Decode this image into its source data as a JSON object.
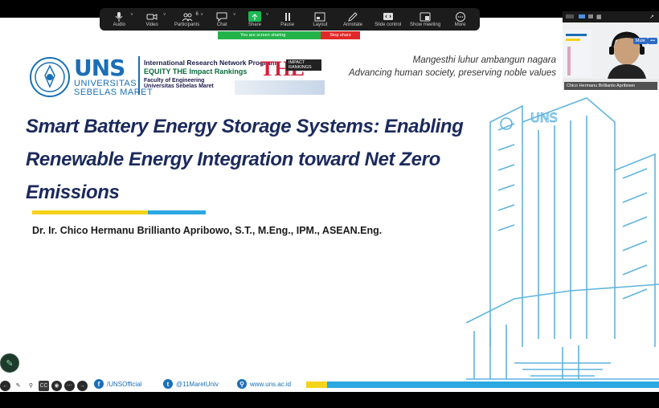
{
  "toolbar": {
    "audio": "Audio",
    "video": "Video",
    "participants": "Participants",
    "participants_count": "6",
    "chat": "Chat",
    "share": "Share",
    "pause": "Pause",
    "layout": "Layout",
    "annotate": "Annotate",
    "slide_control": "Slide control",
    "show_meeting": "Show meeting",
    "more": "More"
  },
  "share_bar": {
    "status": "You are screen sharing",
    "stop": "Stop share"
  },
  "video_tile": {
    "name": "Chico Hermanu Brillianto Apribowo",
    "mute": "Mute",
    "more": "•••"
  },
  "slide": {
    "uns_big": "UNS",
    "uns_line1": "UNIVERSITAS",
    "uns_line2": "SEBELAS MARET",
    "irn_line1": "International Research Network Program",
    "irn_line2": "EQUITY THE Impact Rankings",
    "irn_line3": "Faculty of Engineering",
    "irn_line4": "Universitas Sebelas Maret",
    "the_big": "THE",
    "the_badge1": "IMPACT",
    "the_badge2": "RANKINGS",
    "motto_line1": "Mangesthi luhur ambangun nagara",
    "motto_line2": "Advancing human society, preserving noble values",
    "title_line1": "Smart Battery Energy Storage Systems: Enabling",
    "title_line2": "Renewable Energy Integration toward Net Zero",
    "title_line3": "Emissions",
    "author": "Dr. Ir. Chico Hermanu Brillianto Apribowo, S.T., M.Eng., IPM., ASEAN.Eng.",
    "footer": {
      "facebook": "/UNSOfficial",
      "twitter": "@11MaretUniv",
      "web": "www.uns.ac.id"
    }
  },
  "colors": {
    "title": "#1b2a5c",
    "uns_blue": "#1a6fb5",
    "accent_yellow": "#f5d31a",
    "accent_blue": "#2ba8e0",
    "share_green": "#24b24b",
    "stop_red": "#e02828"
  },
  "icons": {
    "audio": "microphone-icon",
    "video": "camera-icon",
    "participants": "people-icon",
    "chat": "chat-bubble-icon",
    "share": "share-screen-icon",
    "pause": "pause-icon",
    "layout": "layout-icon",
    "annotate": "pencil-icon",
    "slide_control": "slide-control-icon",
    "show_meeting": "window-icon",
    "more": "more-icon"
  }
}
